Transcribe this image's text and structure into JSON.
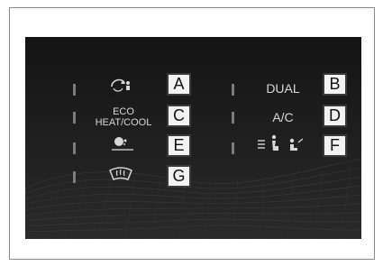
{
  "colors": {
    "panel_background": "#141414",
    "indicator": "#7d7d7d",
    "label_text": "#d8d8d8",
    "callout_fill": "#f2f2f2",
    "callout_border": "#3a3a3a"
  },
  "panel": {
    "buttons": [
      {
        "id": "A",
        "icon": "recirculation-icon",
        "label": ""
      },
      {
        "id": "B",
        "icon": "",
        "label": "DUAL"
      },
      {
        "id": "C",
        "icon": "",
        "label_line1": "ECO",
        "label_line2": "HEAT/COOL"
      },
      {
        "id": "D",
        "icon": "",
        "label": "A/C"
      },
      {
        "id": "E",
        "icon": "nanoe-icon",
        "label": ""
      },
      {
        "id": "F",
        "icon": "airflow-mode-icon",
        "label": ""
      },
      {
        "id": "G",
        "icon": "windshield-defroster-icon",
        "label": ""
      }
    ]
  },
  "callouts": {
    "A": "A",
    "B": "B",
    "C": "C",
    "D": "D",
    "E": "E",
    "F": "F",
    "G": "G"
  }
}
